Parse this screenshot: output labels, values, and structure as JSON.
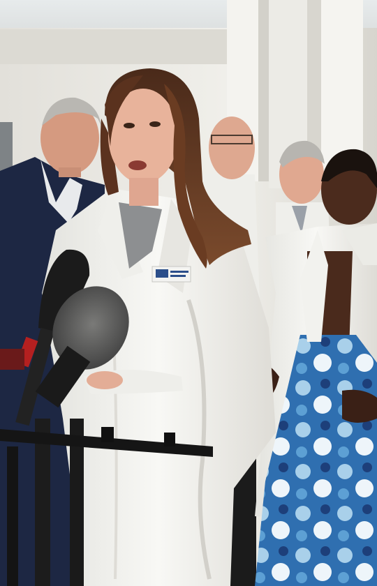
{
  "scene": {
    "colors": {
      "sky": "#dfe3e4",
      "building": "#ecebe6",
      "building_shadow": "#c9c7c0",
      "columns": "#f3f2ee",
      "coat_white": "#f6f6f3",
      "coat_shade": "#dcdcd6",
      "hair": "#5a3320",
      "skin_light": "#e9b8a0",
      "skin_dark": "#4a2a1c",
      "suit_navy": "#1f2a44",
      "mic": "#1b1b1b",
      "mic_fuzz": "#5e5e5e",
      "stand": "#1a1a1a",
      "dress_blue": "#3f79b8",
      "shirt_gray": "#8a8c8e"
    },
    "icons": [
      "microphone-icon",
      "windscreen-icon"
    ]
  }
}
